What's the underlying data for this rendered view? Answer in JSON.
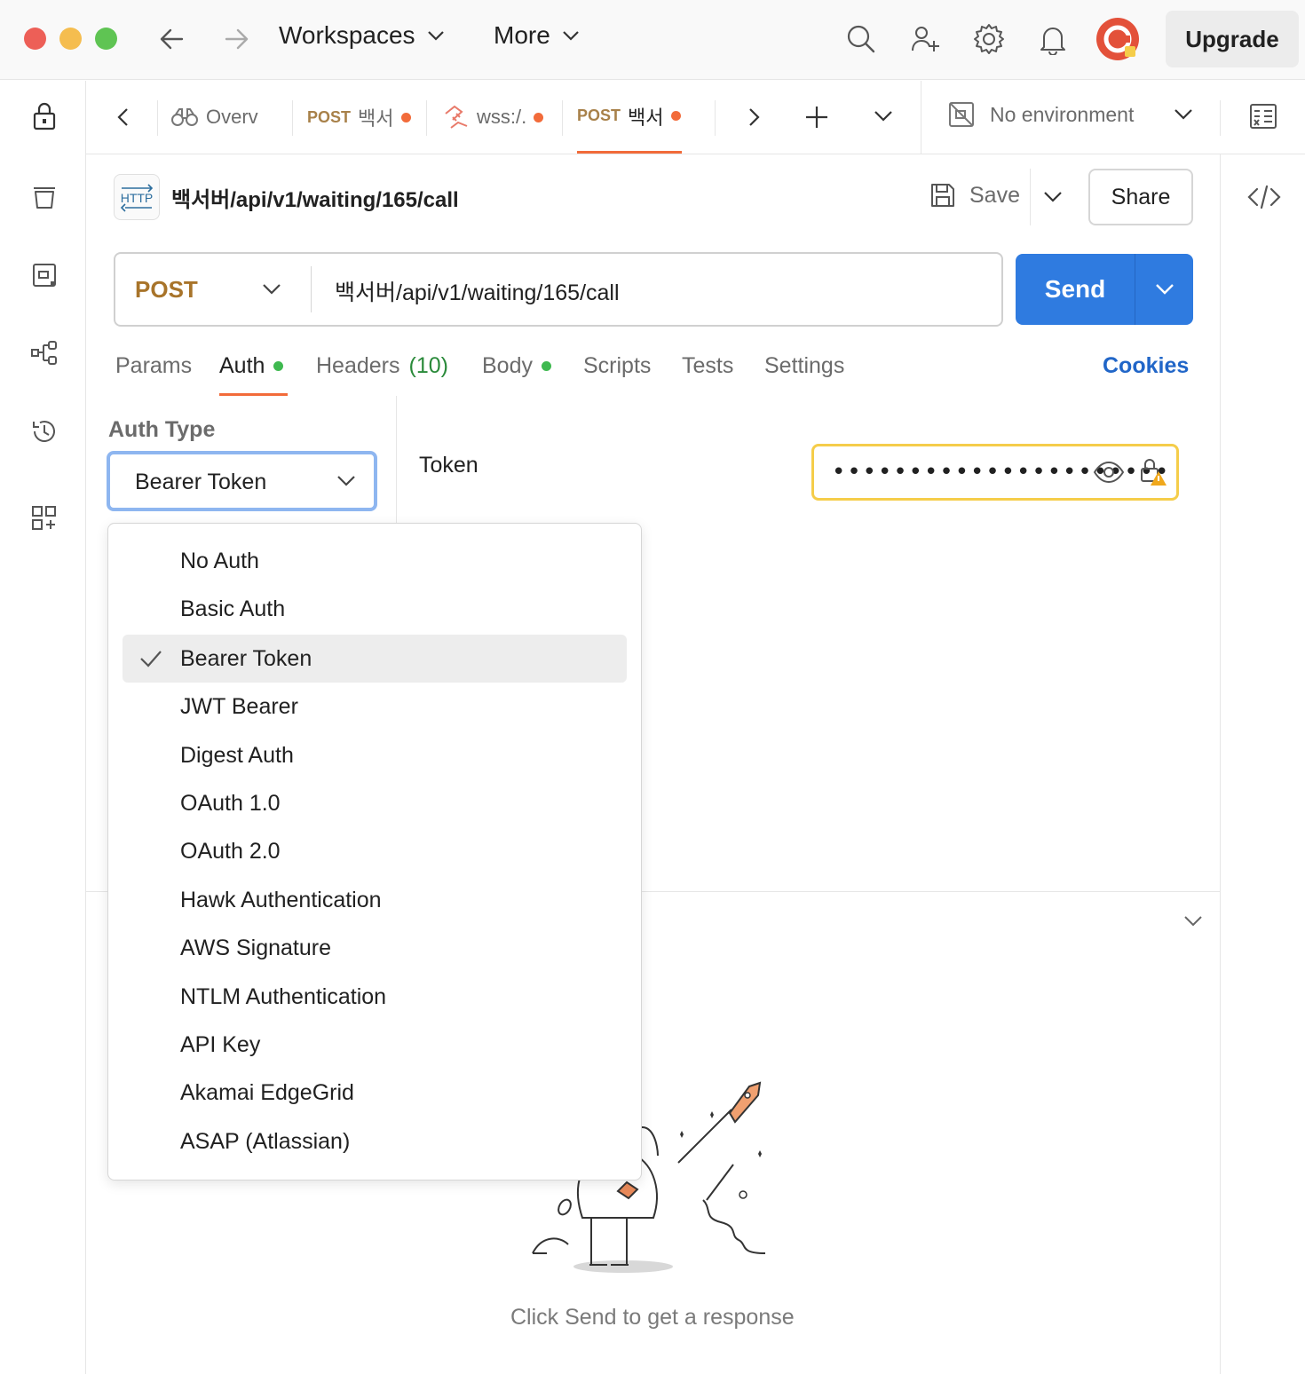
{
  "titlebar": {
    "workspaces_label": "Workspaces",
    "more_label": "More",
    "upgrade_label": "Upgrade"
  },
  "tabs": [
    {
      "label": "Overv",
      "method": "",
      "dirty": false
    },
    {
      "label": "백서",
      "method": "POST",
      "dirty": true
    },
    {
      "label": "wss:/.",
      "method": "",
      "dirty": true
    },
    {
      "label": "백서",
      "method": "POST",
      "dirty": true,
      "active": true
    }
  ],
  "environment": {
    "label": "No environment"
  },
  "request": {
    "title": "백서버/api/v1/waiting/165/call",
    "http_badge": "HTTP",
    "save_label": "Save",
    "share_label": "Share",
    "method": "POST",
    "url": "백서버/api/v1/waiting/165/call",
    "send_label": "Send"
  },
  "request_tabs": {
    "params": "Params",
    "auth": "Auth",
    "headers": "Headers",
    "headers_count": "(10)",
    "body": "Body",
    "scripts": "Scripts",
    "tests": "Tests",
    "settings": "Settings",
    "cookies": "Cookies"
  },
  "auth": {
    "type_label": "Auth Type",
    "selected": "Bearer Token",
    "token_label": "Token",
    "token_masked": "••••••••••••••••••••••",
    "options": [
      "No Auth",
      "Basic Auth",
      "Bearer Token",
      "JWT Bearer",
      "Digest Auth",
      "OAuth 1.0",
      "OAuth 2.0",
      "Hawk Authentication",
      "AWS Signature",
      "NTLM Authentication",
      "API Key",
      "Akamai EdgeGrid",
      "ASAP (Atlassian)"
    ]
  },
  "response": {
    "empty_text": "Click Send to get a response"
  },
  "colors": {
    "accent": "#2f7be0",
    "method": "#a8742a",
    "dirty_dot": "#f26b3a",
    "ok_dot": "#3fb950",
    "token_border": "#f5cd4a"
  }
}
